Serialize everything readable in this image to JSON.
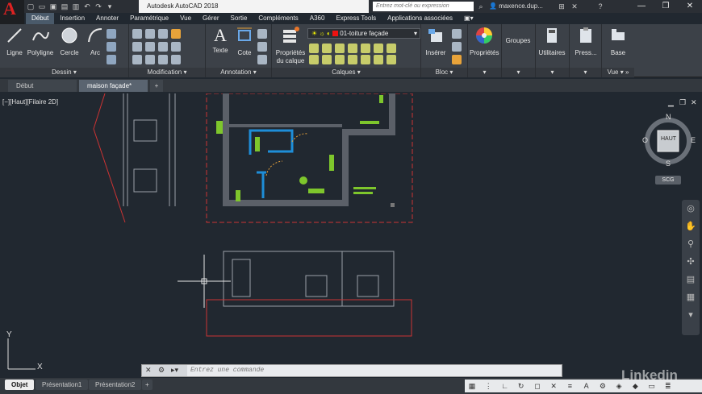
{
  "app": {
    "title": "Autodesk AutoCAD 2018",
    "logo_letter": "A",
    "search_placeholder": "Entrez mot-clé ou expression",
    "user": "maxence.dup...",
    "colors": {
      "accent": "#d22222",
      "ribbon_bg": "#3c4148",
      "canvas_bg": "#212830"
    }
  },
  "ribbon_tabs": [
    "Début",
    "Insertion",
    "Annoter",
    "Paramétrique",
    "Vue",
    "Gérer",
    "Sortie",
    "Compléments",
    "A360",
    "Express Tools",
    "Applications associées"
  ],
  "ribbon": {
    "dessin": {
      "title": "Dessin",
      "tools": [
        "Ligne",
        "Polyligne",
        "Cercle",
        "Arc"
      ]
    },
    "modification": {
      "title": "Modification"
    },
    "annotation": {
      "title": "Annotation",
      "tools": [
        "Texte",
        "Cote"
      ]
    },
    "calques": {
      "title": "Calques",
      "props_label_1": "Propriétés",
      "props_label_2": "du calque",
      "current_layer": "01-toiture façade"
    },
    "bloc": {
      "title": "Bloc",
      "insert_label": "Insérer"
    },
    "proprietes": {
      "label": "Propriétés"
    },
    "groupes": {
      "label": "Groupes"
    },
    "utilitaires": {
      "label": "Utilitaires"
    },
    "presse": {
      "label": "Press..."
    },
    "base": {
      "label": "Base"
    },
    "vue": {
      "title": "Vue"
    }
  },
  "doc_tabs": [
    "Début",
    "maison façade*"
  ],
  "viewport": {
    "label": "[−][Haut][Filaire 2D]",
    "viewcube": {
      "face": "HAUT",
      "n": "N",
      "s": "S",
      "e": "E",
      "o": "O",
      "wcs": "SCG"
    }
  },
  "command": {
    "placeholder": "Entrez une commande"
  },
  "layout_tabs": [
    "Objet",
    "Présentation1",
    "Présentation2"
  ],
  "ucs": {
    "x": "X",
    "y": "Y"
  },
  "watermark": "Linkedin"
}
